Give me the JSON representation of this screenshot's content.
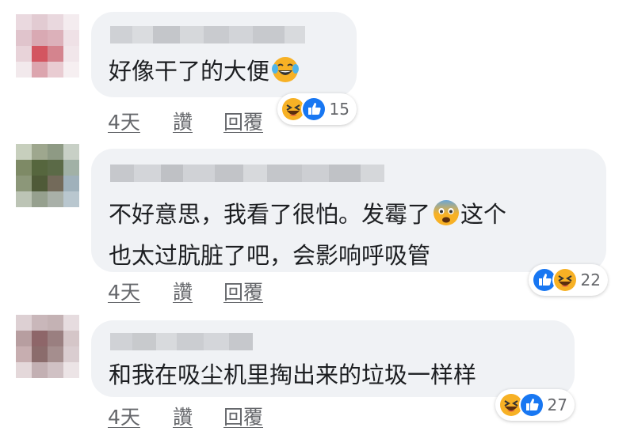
{
  "comments": [
    {
      "text_lines": [
        "好像干了的大便"
      ],
      "inline_emoji": "laughing-tears-emoji",
      "time": "4天",
      "like_label": "讚",
      "reply_label": "回覆",
      "reactions": [
        "haha",
        "like"
      ],
      "reaction_count": "15"
    },
    {
      "text_lines": [
        "不好意思，我看了很怕。发霉了",
        "这个",
        "也太过肮脏了吧，会影响呼吸管"
      ],
      "inline_emoji": "fearful-face-emoji",
      "time": "4天",
      "like_label": "讚",
      "reply_label": "回覆",
      "reactions": [
        "like",
        "haha"
      ],
      "reaction_count": "22"
    },
    {
      "text_lines": [
        "和我在吸尘机里掏出来的垃圾一样样"
      ],
      "time": "4天",
      "like_label": "讚",
      "reply_label": "回覆",
      "reactions": [
        "haha",
        "like"
      ],
      "reaction_count": "27"
    }
  ],
  "colors": {
    "bubble": "#f0f2f5",
    "like_blue": "#1877f2",
    "haha_yellow": "#f7b125",
    "meta_text": "#65676b"
  }
}
